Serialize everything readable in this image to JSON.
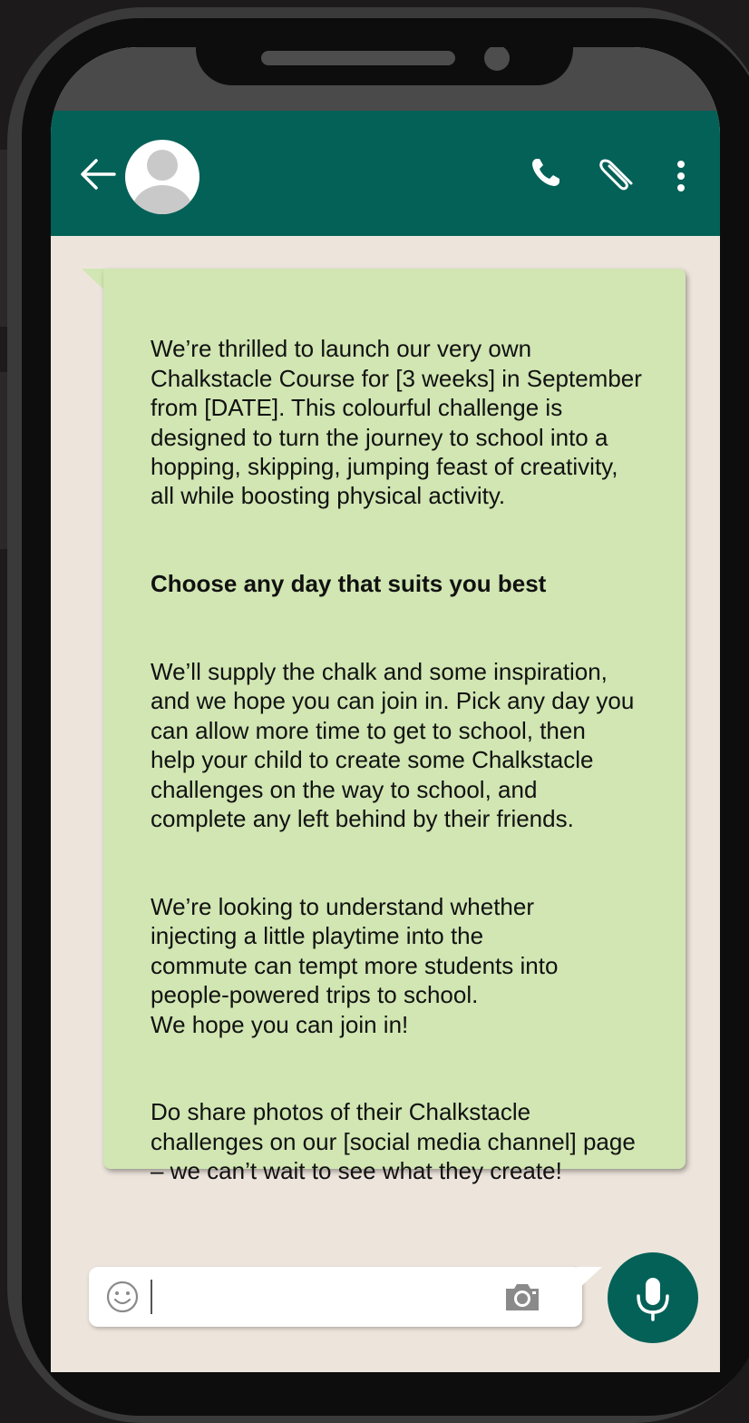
{
  "colors": {
    "header": "#036157",
    "chat_background": "#ede5dc",
    "bubble": "#d1e6b2",
    "mic_button": "#036157"
  },
  "header": {
    "back_icon": "arrow-left-icon",
    "avatar_icon": "default-user-avatar-icon",
    "actions": [
      {
        "icon": "phone-icon"
      },
      {
        "icon": "paperclip-icon"
      },
      {
        "icon": "more-vertical-icon"
      }
    ]
  },
  "message": {
    "paragraphs": [
      {
        "text": "We’re thrilled to launch our very own\nChalkstacle Course for [3 weeks] in September\nfrom [DATE]. This colourful challenge is\ndesigned to turn the journey to school into a\nhopping, skipping, jumping feast of creativity,\nall while boosting physical activity."
      },
      {
        "text": "Choose any day that suits you best"
      },
      {
        "text": "We’ll supply the chalk and some inspiration,\nand we hope you can join in. Pick any day you\ncan allow more time to get to school, then\nhelp your child to create some Chalkstacle\nchallenges on the way to school, and\ncomplete any left behind by their friends."
      },
      {
        "text": "We’re looking to understand whether\ninjecting a little playtime into the\ncommute can tempt more students into\npeople-powered trips to school.\n We hope you can join in!"
      },
      {
        "text": "Do share photos of their Chalkstacle\nchallenges on our [social media channel] page\n– we can’t wait to see what they create!"
      }
    ]
  },
  "composer": {
    "value": "",
    "emoji_icon": "smiley-icon",
    "camera_icon": "camera-icon",
    "mic_icon": "microphone-icon"
  }
}
